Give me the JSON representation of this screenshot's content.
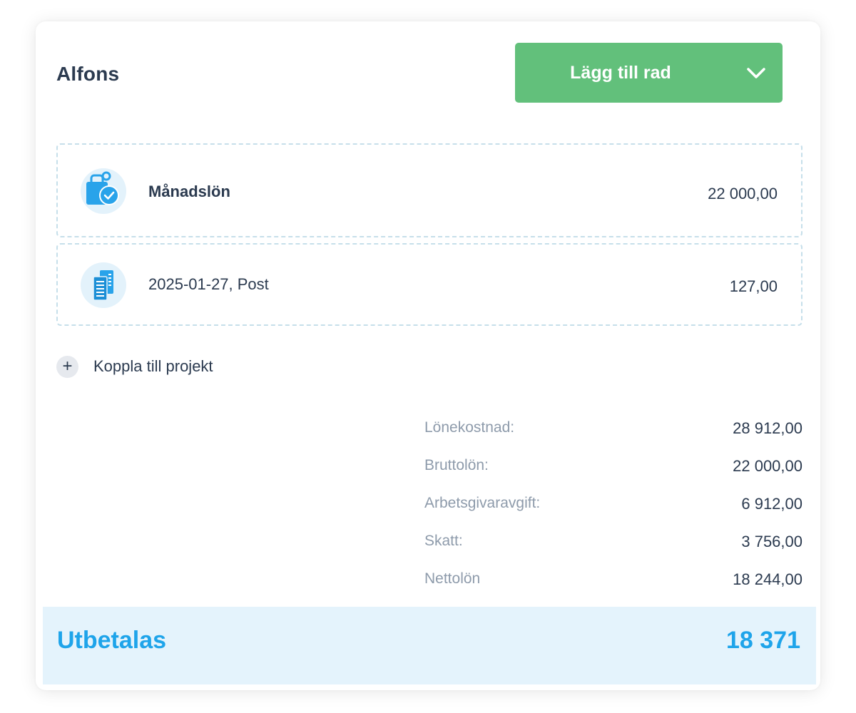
{
  "employee": {
    "name": "Alfons"
  },
  "add_row_button": {
    "label": "Lägg till rad",
    "icon": "chevron-down-icon"
  },
  "rows": [
    {
      "title": "Månadslön",
      "amount": "22 000,00",
      "icon": "salary-briefcase-icon"
    },
    {
      "title": "2025-01-27, Post",
      "amount": "127,00",
      "icon": "receipt-documents-icon"
    }
  ],
  "project_link": {
    "label": "Koppla till projekt",
    "icon": "plus-icon"
  },
  "summary": [
    {
      "label": "Lönekostnad:",
      "value": "28 912,00"
    },
    {
      "label": "Bruttolön:",
      "value": "22 000,00"
    },
    {
      "label": "Arbetsgivaravgift:",
      "value": "6 912,00"
    },
    {
      "label": "Skatt:",
      "value": "3 756,00"
    },
    {
      "label": "Nettolön",
      "value": "18 244,00"
    }
  ],
  "payout": {
    "label": "Utbetalas",
    "value": "18 371"
  },
  "colors": {
    "primary_green": "#62c07b",
    "accent_blue": "#1ea4ea",
    "text_dark": "#2b3a4f",
    "text_muted": "#8e9bab",
    "payout_background": "#e4f3fc",
    "dashed_border": "#c6dfea"
  }
}
